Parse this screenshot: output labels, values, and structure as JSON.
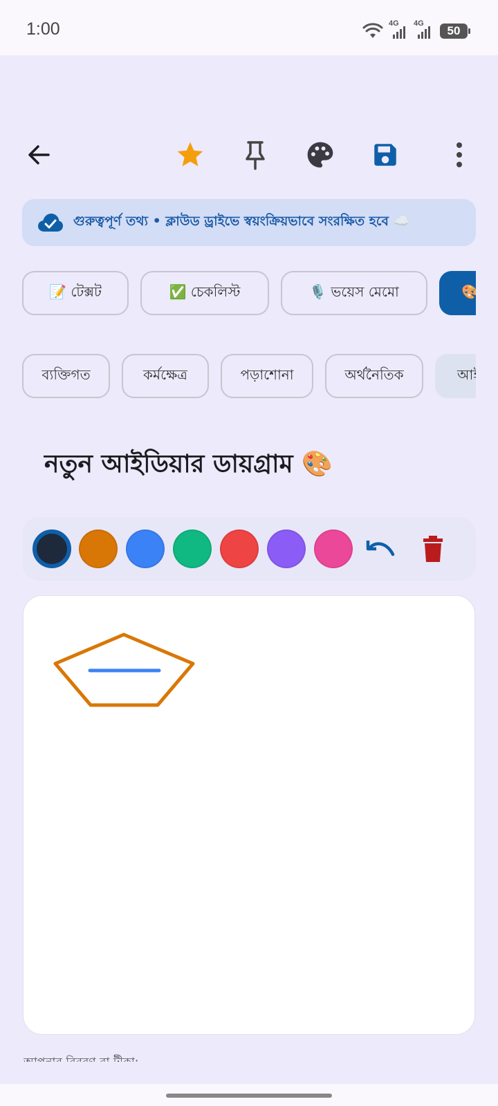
{
  "status_bar": {
    "time": "1:00",
    "network_1": "4G",
    "network_2": "4G",
    "battery": "50"
  },
  "toolbar": {
    "back_icon": "arrow-left-icon",
    "favorite_icon": "star-icon",
    "pin_icon": "pin-icon",
    "color_icon": "palette-icon",
    "save_icon": "save-icon",
    "menu_icon": "more-vert-icon",
    "favorite_color": "#F59E0B",
    "save_color": "#0F5FA8"
  },
  "banner": {
    "icon": "cloud-check-icon",
    "text": "গুরুত্বপূর্ণ তথ্য • ক্লাউড ড্রাইভে স্বয়ংক্রিয়ভাবে সংরক্ষিত হবে ☁️"
  },
  "note_types": [
    {
      "label": "📝 টেক্সট"
    },
    {
      "label": "✅ চেকলিস্ট"
    },
    {
      "label": "🎙️ ভয়েস মেমো"
    },
    {
      "label": "🎨 ডায়াগ্রাম"
    }
  ],
  "categories": [
    {
      "label": "ব্যক্তিগত"
    },
    {
      "label": "কর্মক্ষেত্র"
    },
    {
      "label": "পড়াশোনা"
    },
    {
      "label": "অর্থনৈতিক"
    },
    {
      "label": "আইডিয়া"
    }
  ],
  "note": {
    "title": "নতুন আইডিয়ার ডায়গ্রাম 🎨"
  },
  "palette": {
    "colors": [
      "#1E293B",
      "#D97706",
      "#3B82F6",
      "#10B981",
      "#EF4444",
      "#8B5CF6",
      "#EC4899"
    ],
    "selected_index": 0,
    "undo_icon": "undo-icon",
    "clear_icon": "trash-icon",
    "clear_color": "#B91C1C"
  },
  "drawing": {
    "shapes": [
      "pentagon",
      "line"
    ],
    "pentagon_color": "#D97706",
    "line_color": "#3B82F6"
  },
  "footer": {
    "text": "আপনার বিবরণ বা টীকা:"
  }
}
